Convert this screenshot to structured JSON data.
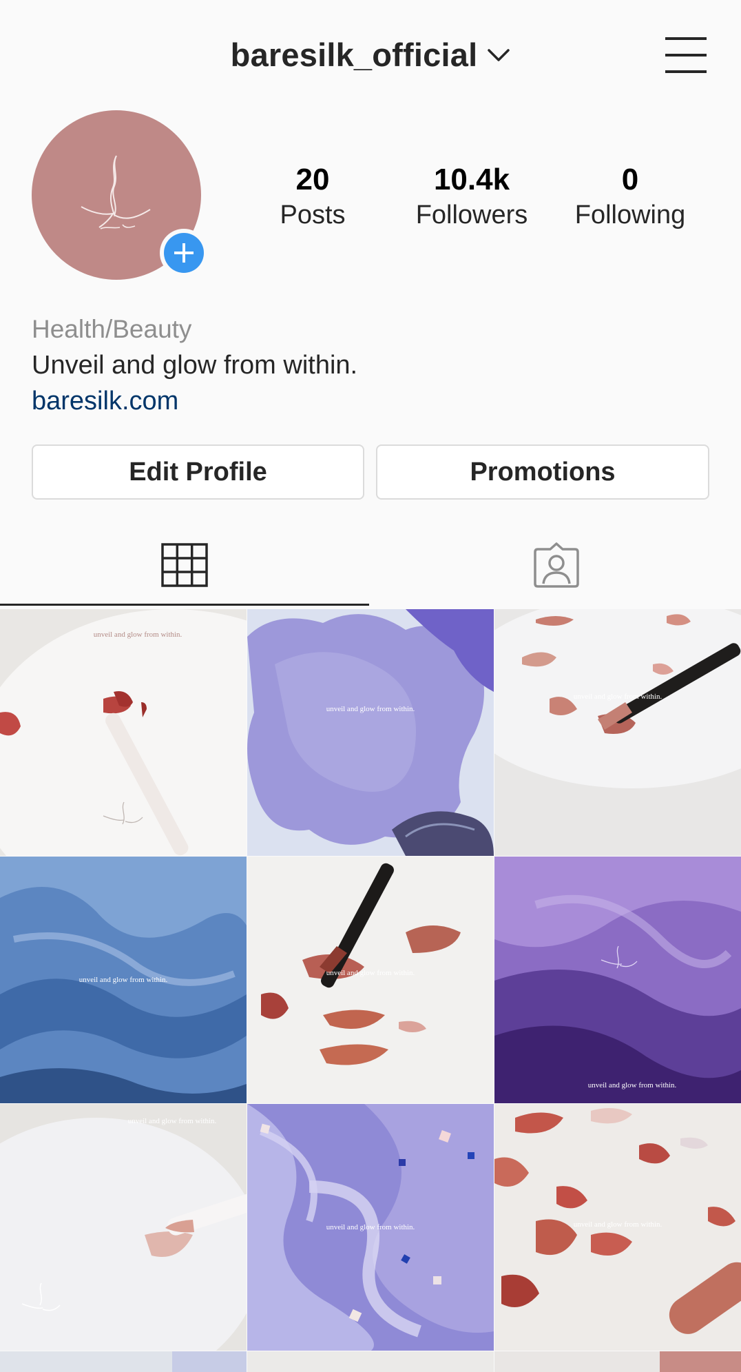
{
  "header": {
    "username": "baresilk_official",
    "dropdown_icon": "chevron-down-icon",
    "menu_icon": "hamburger-menu-icon"
  },
  "profile": {
    "avatar_icon": "brand-logo",
    "add_story_icon": "plus-icon",
    "stats": [
      {
        "value": "20",
        "label": "Posts"
      },
      {
        "value": "10.4k",
        "label": "Followers"
      },
      {
        "value": "0",
        "label": "Following"
      }
    ],
    "category": "Health/Beauty",
    "bio": "Unveil and glow from within.",
    "website": "baresilk.com"
  },
  "actions": {
    "edit_profile": "Edit Profile",
    "promotions": "Promotions"
  },
  "tabs": [
    {
      "name": "grid",
      "icon": "grid-icon",
      "active": true
    },
    {
      "name": "tagged",
      "icon": "tagged-person-icon",
      "active": false
    }
  ],
  "posts": [
    {
      "caption": "unveil and glow from within."
    },
    {
      "caption": "unveil and glow from within."
    },
    {
      "caption": "unveil and glow from within."
    },
    {
      "caption": "unveil and glow from within."
    },
    {
      "caption": "unveil and glow from within."
    },
    {
      "caption": "unveil and glow from within."
    },
    {
      "caption": "unveil and glow from within."
    },
    {
      "caption": "unveil and glow from within."
    },
    {
      "caption": "unveil and glow from within."
    }
  ],
  "colors": {
    "avatar_bg": "#bf8987",
    "accent_blue": "#3897f0",
    "link": "#003569",
    "muted": "#8e8e8e",
    "border": "#dbdbdb"
  }
}
